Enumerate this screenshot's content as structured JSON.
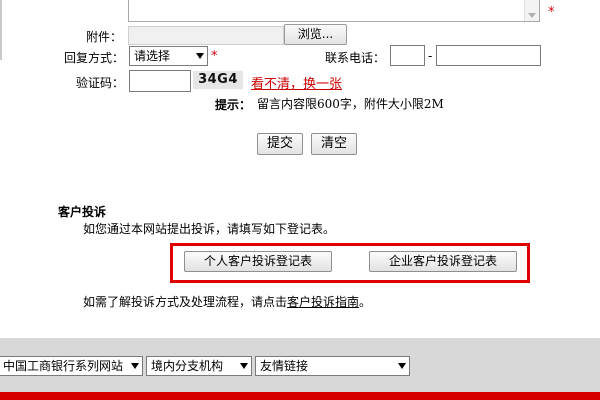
{
  "form": {
    "attachment_label": "附件：",
    "browse_label": "浏览...",
    "reply_method_label": "回复方式：",
    "reply_method_value": "请选择",
    "phone_label": "联系电话：",
    "phone_separator": "-",
    "captcha_label": "验证码：",
    "captcha_text": "34G4",
    "captcha_refresh_link": "看不清，换一张",
    "tip_key": "提示：",
    "tip_text": "留言内容限600字，附件大小限2M",
    "submit_label": "提交",
    "clear_label": "清空",
    "required_mark": "*"
  },
  "complaints": {
    "title": "客户投诉",
    "description": "如您通过本网站提出投诉，请填写如下登记表。",
    "personal_button": "个人客户投诉登记表",
    "enterprise_button": "企业客户投诉登记表",
    "note_prefix": "如需了解投诉方式及处理流程，请点击",
    "note_link": "客户投诉指南",
    "note_suffix": "。"
  },
  "footer": {
    "select_1": "中国工商银行系列网站",
    "select_2": "境内分支机构",
    "select_3": "友情链接"
  },
  "colors": {
    "accent_red": "#e00000",
    "link_red": "#cc0000",
    "footer_gray": "#d8d8d8"
  }
}
